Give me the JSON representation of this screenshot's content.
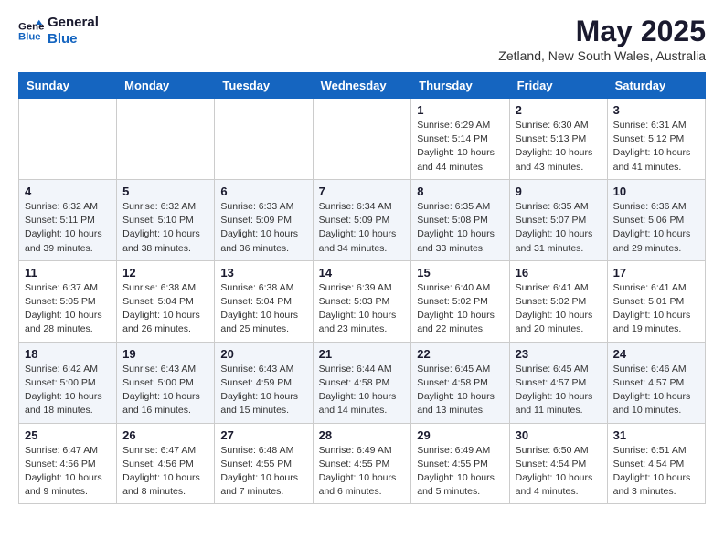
{
  "logo": {
    "line1": "General",
    "line2": "Blue"
  },
  "header": {
    "month": "May 2025",
    "location": "Zetland, New South Wales, Australia"
  },
  "weekdays": [
    "Sunday",
    "Monday",
    "Tuesday",
    "Wednesday",
    "Thursday",
    "Friday",
    "Saturday"
  ],
  "weeks": [
    [
      {
        "day": "",
        "info": ""
      },
      {
        "day": "",
        "info": ""
      },
      {
        "day": "",
        "info": ""
      },
      {
        "day": "",
        "info": ""
      },
      {
        "day": "1",
        "info": "Sunrise: 6:29 AM\nSunset: 5:14 PM\nDaylight: 10 hours\nand 44 minutes."
      },
      {
        "day": "2",
        "info": "Sunrise: 6:30 AM\nSunset: 5:13 PM\nDaylight: 10 hours\nand 43 minutes."
      },
      {
        "day": "3",
        "info": "Sunrise: 6:31 AM\nSunset: 5:12 PM\nDaylight: 10 hours\nand 41 minutes."
      }
    ],
    [
      {
        "day": "4",
        "info": "Sunrise: 6:32 AM\nSunset: 5:11 PM\nDaylight: 10 hours\nand 39 minutes."
      },
      {
        "day": "5",
        "info": "Sunrise: 6:32 AM\nSunset: 5:10 PM\nDaylight: 10 hours\nand 38 minutes."
      },
      {
        "day": "6",
        "info": "Sunrise: 6:33 AM\nSunset: 5:09 PM\nDaylight: 10 hours\nand 36 minutes."
      },
      {
        "day": "7",
        "info": "Sunrise: 6:34 AM\nSunset: 5:09 PM\nDaylight: 10 hours\nand 34 minutes."
      },
      {
        "day": "8",
        "info": "Sunrise: 6:35 AM\nSunset: 5:08 PM\nDaylight: 10 hours\nand 33 minutes."
      },
      {
        "day": "9",
        "info": "Sunrise: 6:35 AM\nSunset: 5:07 PM\nDaylight: 10 hours\nand 31 minutes."
      },
      {
        "day": "10",
        "info": "Sunrise: 6:36 AM\nSunset: 5:06 PM\nDaylight: 10 hours\nand 29 minutes."
      }
    ],
    [
      {
        "day": "11",
        "info": "Sunrise: 6:37 AM\nSunset: 5:05 PM\nDaylight: 10 hours\nand 28 minutes."
      },
      {
        "day": "12",
        "info": "Sunrise: 6:38 AM\nSunset: 5:04 PM\nDaylight: 10 hours\nand 26 minutes."
      },
      {
        "day": "13",
        "info": "Sunrise: 6:38 AM\nSunset: 5:04 PM\nDaylight: 10 hours\nand 25 minutes."
      },
      {
        "day": "14",
        "info": "Sunrise: 6:39 AM\nSunset: 5:03 PM\nDaylight: 10 hours\nand 23 minutes."
      },
      {
        "day": "15",
        "info": "Sunrise: 6:40 AM\nSunset: 5:02 PM\nDaylight: 10 hours\nand 22 minutes."
      },
      {
        "day": "16",
        "info": "Sunrise: 6:41 AM\nSunset: 5:02 PM\nDaylight: 10 hours\nand 20 minutes."
      },
      {
        "day": "17",
        "info": "Sunrise: 6:41 AM\nSunset: 5:01 PM\nDaylight: 10 hours\nand 19 minutes."
      }
    ],
    [
      {
        "day": "18",
        "info": "Sunrise: 6:42 AM\nSunset: 5:00 PM\nDaylight: 10 hours\nand 18 minutes."
      },
      {
        "day": "19",
        "info": "Sunrise: 6:43 AM\nSunset: 5:00 PM\nDaylight: 10 hours\nand 16 minutes."
      },
      {
        "day": "20",
        "info": "Sunrise: 6:43 AM\nSunset: 4:59 PM\nDaylight: 10 hours\nand 15 minutes."
      },
      {
        "day": "21",
        "info": "Sunrise: 6:44 AM\nSunset: 4:58 PM\nDaylight: 10 hours\nand 14 minutes."
      },
      {
        "day": "22",
        "info": "Sunrise: 6:45 AM\nSunset: 4:58 PM\nDaylight: 10 hours\nand 13 minutes."
      },
      {
        "day": "23",
        "info": "Sunrise: 6:45 AM\nSunset: 4:57 PM\nDaylight: 10 hours\nand 11 minutes."
      },
      {
        "day": "24",
        "info": "Sunrise: 6:46 AM\nSunset: 4:57 PM\nDaylight: 10 hours\nand 10 minutes."
      }
    ],
    [
      {
        "day": "25",
        "info": "Sunrise: 6:47 AM\nSunset: 4:56 PM\nDaylight: 10 hours\nand 9 minutes."
      },
      {
        "day": "26",
        "info": "Sunrise: 6:47 AM\nSunset: 4:56 PM\nDaylight: 10 hours\nand 8 minutes."
      },
      {
        "day": "27",
        "info": "Sunrise: 6:48 AM\nSunset: 4:55 PM\nDaylight: 10 hours\nand 7 minutes."
      },
      {
        "day": "28",
        "info": "Sunrise: 6:49 AM\nSunset: 4:55 PM\nDaylight: 10 hours\nand 6 minutes."
      },
      {
        "day": "29",
        "info": "Sunrise: 6:49 AM\nSunset: 4:55 PM\nDaylight: 10 hours\nand 5 minutes."
      },
      {
        "day": "30",
        "info": "Sunrise: 6:50 AM\nSunset: 4:54 PM\nDaylight: 10 hours\nand 4 minutes."
      },
      {
        "day": "31",
        "info": "Sunrise: 6:51 AM\nSunset: 4:54 PM\nDaylight: 10 hours\nand 3 minutes."
      }
    ]
  ]
}
